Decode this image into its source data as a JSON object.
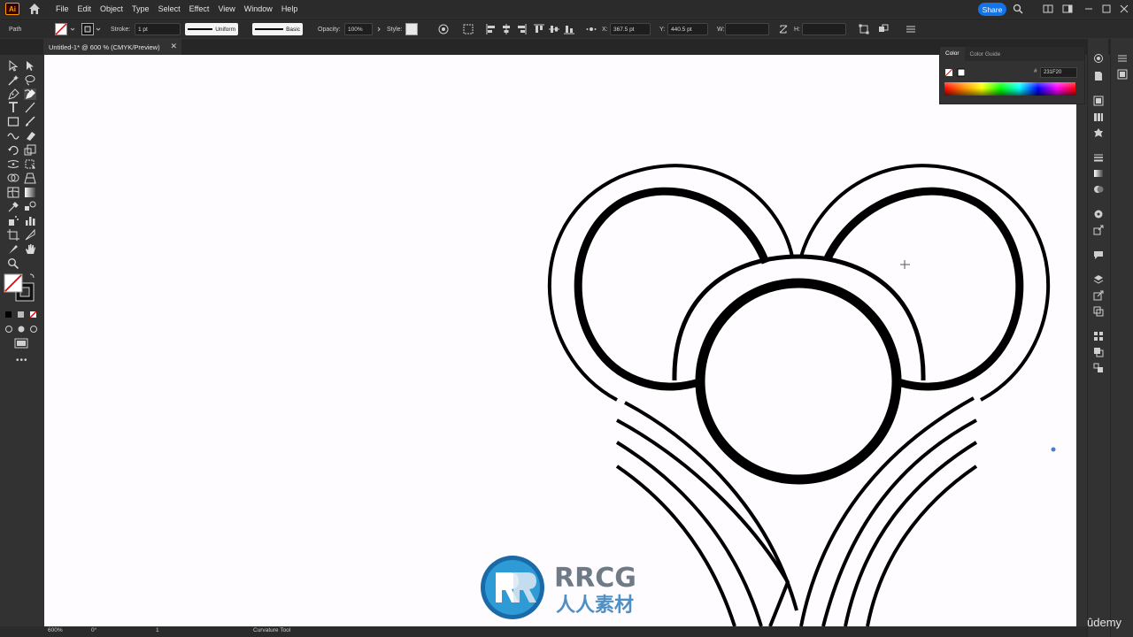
{
  "app": {
    "logo": "Ai",
    "menu": [
      "File",
      "Edit",
      "Object",
      "Type",
      "Select",
      "Effect",
      "View",
      "Window",
      "Help"
    ],
    "share_label": "Share",
    "accent_color": "#1473e6"
  },
  "control_bar": {
    "selection_type": "Path",
    "stroke_label": "Stroke:",
    "stroke_weight": "1 pt",
    "stroke_profile": "Uniform",
    "brush": "Basic",
    "opacity_label": "Opacity:",
    "opacity_value": "100%",
    "style_label": "Style:",
    "x_label": "X:",
    "x_value": "367.5 pt",
    "y_label": "Y:",
    "y_value": "440.5 pt",
    "w_label": "W:",
    "h_label": "H:"
  },
  "document_tab": {
    "title": "Untitled-1* @ 600 % (CMYK/Preview)",
    "close_icon": "close-icon"
  },
  "color_panel": {
    "tab_color": "Color",
    "tab_guide": "Color Guide",
    "hex_symbol": "#",
    "hex_value": "231F20"
  },
  "status_bar": {
    "zoom": "600%",
    "rotation": "0°",
    "artboard": "1",
    "tool_name": "Curvature Tool"
  },
  "watermark": {
    "line1": "RRCG",
    "line2": "人人素材"
  },
  "brand": {
    "udemy": "ûdemy"
  }
}
